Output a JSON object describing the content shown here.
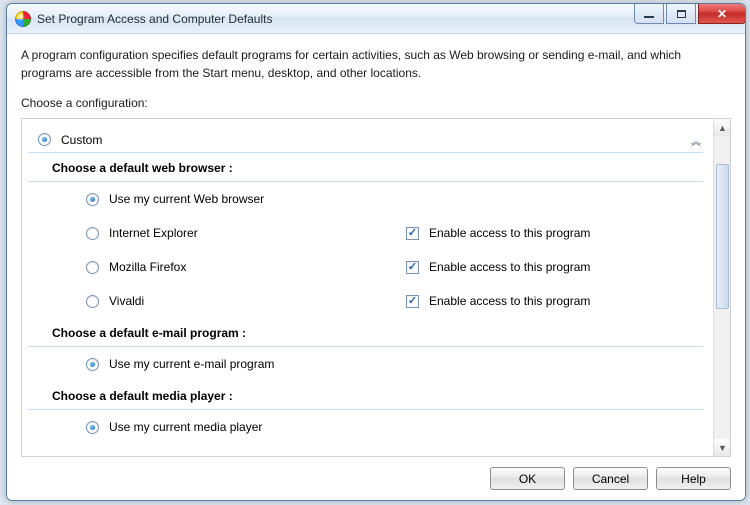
{
  "window": {
    "title": "Set Program Access and Computer Defaults"
  },
  "intro": "A program configuration specifies default programs for certain activities, such as Web browsing or sending e-mail, and which programs are accessible from the Start menu, desktop, and other locations.",
  "choose_label": "Choose a configuration:",
  "config": {
    "custom_label": "Custom",
    "sections": {
      "browser": {
        "title": "Choose a default web browser :",
        "options": {
          "current": "Use my current Web browser",
          "ie": "Internet Explorer",
          "firefox": "Mozilla Firefox",
          "vivaldi": "Vivaldi"
        }
      },
      "email": {
        "title": "Choose a default e-mail program :",
        "options": {
          "current": "Use my current e-mail program"
        }
      },
      "media": {
        "title": "Choose a default media player :",
        "options": {
          "current": "Use my current media player"
        }
      }
    },
    "enable_access_label": "Enable access to this program"
  },
  "buttons": {
    "ok": "OK",
    "cancel": "Cancel",
    "help": "Help"
  }
}
